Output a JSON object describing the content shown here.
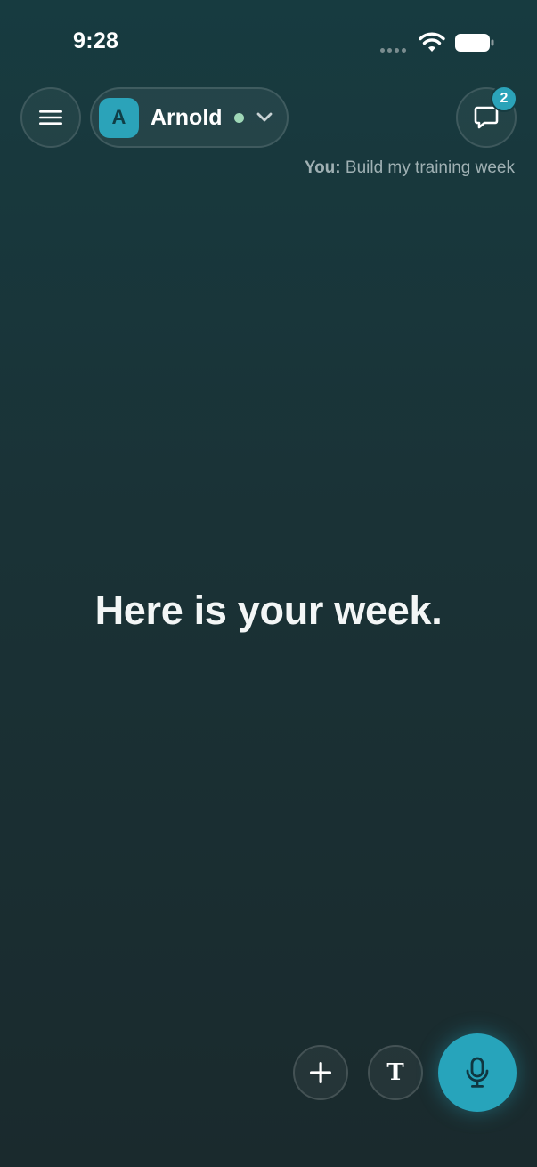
{
  "status_bar": {
    "time": "9:28",
    "icons": [
      "signal-dots-icon",
      "wifi-icon",
      "battery-icon"
    ]
  },
  "header": {
    "menu_icon": "hamburger-menu-icon",
    "agent": {
      "initial": "A",
      "name": "Arnold",
      "status_color": "#9fd8b7"
    },
    "chat": {
      "icon": "chat-bubble-icon",
      "badge_count": "2"
    }
  },
  "last_message": {
    "sender": "You:",
    "text": " Build my training week"
  },
  "main": {
    "headline": "Here is your week."
  },
  "controls": {
    "add_icon": "plus-icon",
    "text_glyph": "T",
    "mic_icon": "microphone-icon",
    "accent_color": "#27a4bb"
  }
}
